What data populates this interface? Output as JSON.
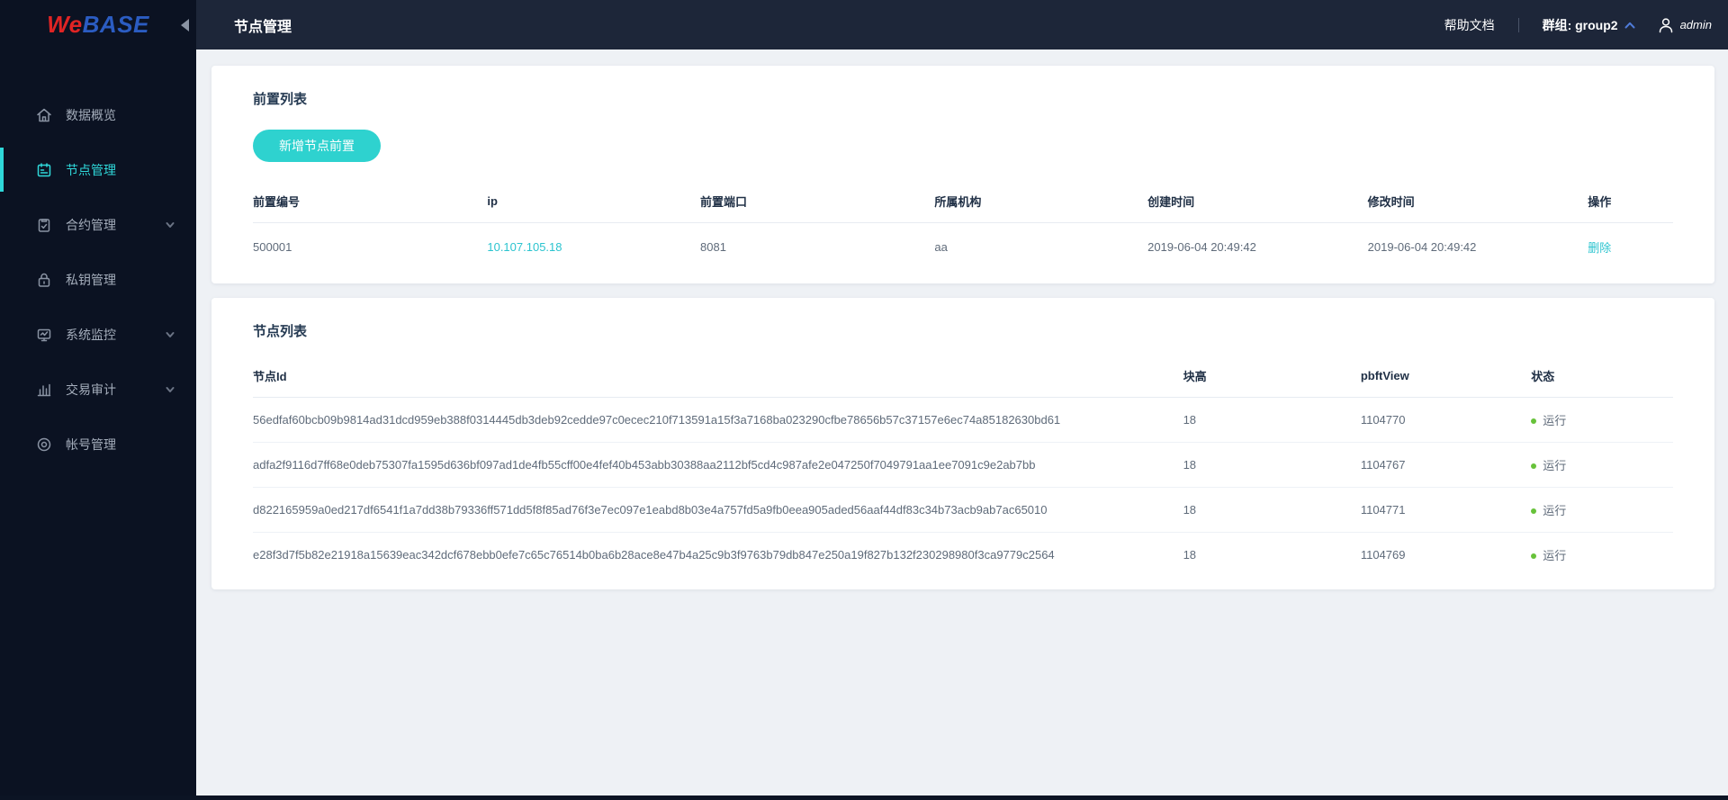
{
  "app": {
    "logo_we": "We",
    "logo_base": "BASE"
  },
  "header": {
    "title": "节点管理",
    "help_label": "帮助文档",
    "group_label": "群组: group2",
    "user_name": "admin"
  },
  "sidebar": {
    "items": [
      {
        "label": "数据概览",
        "icon": "home-icon",
        "active": false,
        "expandable": false
      },
      {
        "label": "节点管理",
        "icon": "node-icon",
        "active": true,
        "expandable": false
      },
      {
        "label": "合约管理",
        "icon": "contract-icon",
        "active": false,
        "expandable": true
      },
      {
        "label": "私钥管理",
        "icon": "lock-icon",
        "active": false,
        "expandable": false
      },
      {
        "label": "系统监控",
        "icon": "monitor-icon",
        "active": false,
        "expandable": true
      },
      {
        "label": "交易审计",
        "icon": "audit-icon",
        "active": false,
        "expandable": true
      },
      {
        "label": "帐号管理",
        "icon": "account-icon",
        "active": false,
        "expandable": false
      }
    ]
  },
  "front_card": {
    "title": "前置列表",
    "add_button_label": "新增节点前置",
    "headers": [
      "前置编号",
      "ip",
      "前置端口",
      "所属机构",
      "创建时间",
      "修改时间",
      "操作"
    ],
    "row": {
      "front_id": "500001",
      "ip": "10.107.105.18",
      "port": "8081",
      "agency": "aa",
      "create_time": "2019-06-04 20:49:42",
      "modify_time": "2019-06-04 20:49:42",
      "action": "删除"
    }
  },
  "node_card": {
    "title": "节点列表",
    "headers": [
      "节点Id",
      "块高",
      "pbftView",
      "状态"
    ],
    "rows": [
      {
        "node_id": "56edfaf60bcb09b9814ad31dcd959eb388f0314445db3deb92cedde97c0ecec210f713591a15f3a7168ba023290cfbe78656b57c37157e6ec74a85182630bd61",
        "block_height": "18",
        "pbft_view": "1104770",
        "status": "运行"
      },
      {
        "node_id": "adfa2f9116d7ff68e0deb75307fa1595d636bf097ad1de4fb55cff00e4fef40b453abb30388aa2112bf5cd4c987afe2e047250f7049791aa1ee7091c9e2ab7bb",
        "block_height": "18",
        "pbft_view": "1104767",
        "status": "运行"
      },
      {
        "node_id": "d822165959a0ed217df6541f1a7dd38b79336ff571dd5f8f85ad76f3e7ec097e1eabd8b03e4a757fd5a9fb0eea905aded56aaf44df83c34b73acb9ab7ac65010",
        "block_height": "18",
        "pbft_view": "1104771",
        "status": "运行"
      },
      {
        "node_id": "e28f3d7f5b82e21918a15639eac342dcf678ebb0efe7c65c76514b0ba6b28ace8e47b4a25c9b3f9763b79db847e250a19f827b132f230298980f3ca9779c2564",
        "block_height": "18",
        "pbft_view": "1104769",
        "status": "运行"
      }
    ]
  },
  "colors": {
    "sidebar_bg": "#0b1222",
    "header_bg": "#1d2639",
    "accent_cyan": "#2cc4cf",
    "active_menu_cyan": "#2fd8da",
    "button_teal": "#2ed2cf",
    "status_green": "#67c23a",
    "logo_red": "#e02424",
    "logo_blue": "#2b5cc2"
  }
}
